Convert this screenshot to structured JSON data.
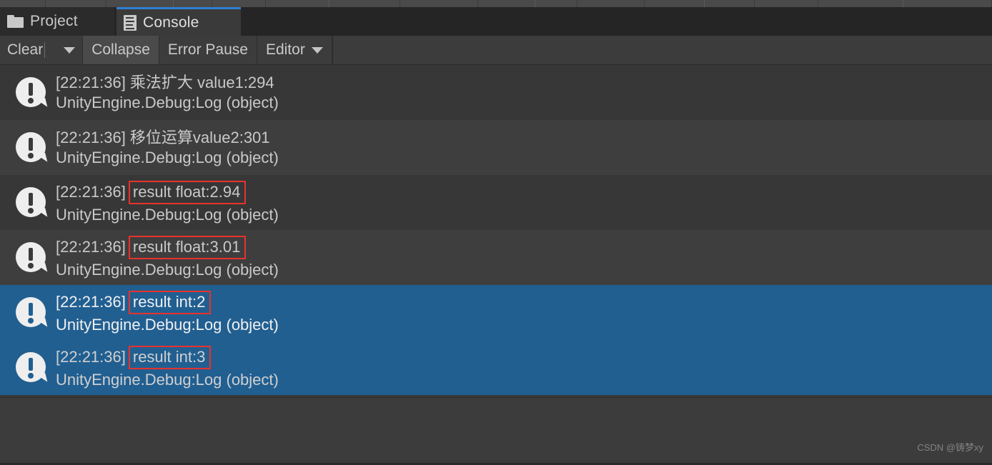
{
  "window": {
    "top_strip_segments": [
      65,
      85,
      95,
      55,
      75,
      90,
      100,
      110,
      80,
      60,
      95,
      85,
      70,
      90,
      120,
      125
    ]
  },
  "tabs": [
    {
      "label": "Project",
      "icon": "folder-icon",
      "active": false
    },
    {
      "label": "Console",
      "icon": "console-doc-icon",
      "active": true
    }
  ],
  "toolbar": {
    "clear_label": "Clear",
    "clear_dropdown_icon": "chevron-down-icon",
    "collapse_label": "Collapse",
    "error_pause_label": "Error Pause",
    "editor_label": "Editor",
    "editor_dropdown_icon": "chevron-down-icon"
  },
  "colors": {
    "selection_blue": "#215f91",
    "tab_accent_blue": "#2f7fd1",
    "highlight_red": "#e8322c",
    "row_even": "#373737",
    "row_odd": "#3e3e3e",
    "toolbar_bg": "#3c3c3c"
  },
  "log_entries": [
    {
      "icon": "log-message-icon",
      "timestamp": "[22:21:36]",
      "message": "乘法扩大 value1:294",
      "stacktrace": "UnityEngine.Debug:Log (object)",
      "selected": false,
      "highlighted": false,
      "row_shade": "even"
    },
    {
      "icon": "log-message-icon",
      "timestamp": "[22:21:36]",
      "message": "移位运算value2:301",
      "stacktrace": "UnityEngine.Debug:Log (object)",
      "selected": false,
      "highlighted": false,
      "row_shade": "odd"
    },
    {
      "icon": "log-message-icon",
      "timestamp": "[22:21:36]",
      "message": "result float:2.94",
      "stacktrace": "UnityEngine.Debug:Log (object)",
      "selected": false,
      "highlighted": true,
      "row_shade": "even"
    },
    {
      "icon": "log-message-icon",
      "timestamp": "[22:21:36]",
      "message": "result float:3.01",
      "stacktrace": "UnityEngine.Debug:Log (object)",
      "selected": false,
      "highlighted": true,
      "row_shade": "odd"
    },
    {
      "icon": "log-message-icon",
      "timestamp": "[22:21:36]",
      "message": "result int:2",
      "stacktrace": "UnityEngine.Debug:Log (object)",
      "selected": true,
      "highlighted": true,
      "row_shade": "sel"
    },
    {
      "icon": "log-message-icon",
      "timestamp": "[22:21:36]",
      "message": "result int:3",
      "stacktrace": "UnityEngine.Debug:Log (object)",
      "selected": true,
      "highlighted": true,
      "row_shade": "sel-dim"
    }
  ],
  "detail_pane": {
    "content": ""
  },
  "watermark": {
    "text": "CSDN @铸梦xy"
  }
}
